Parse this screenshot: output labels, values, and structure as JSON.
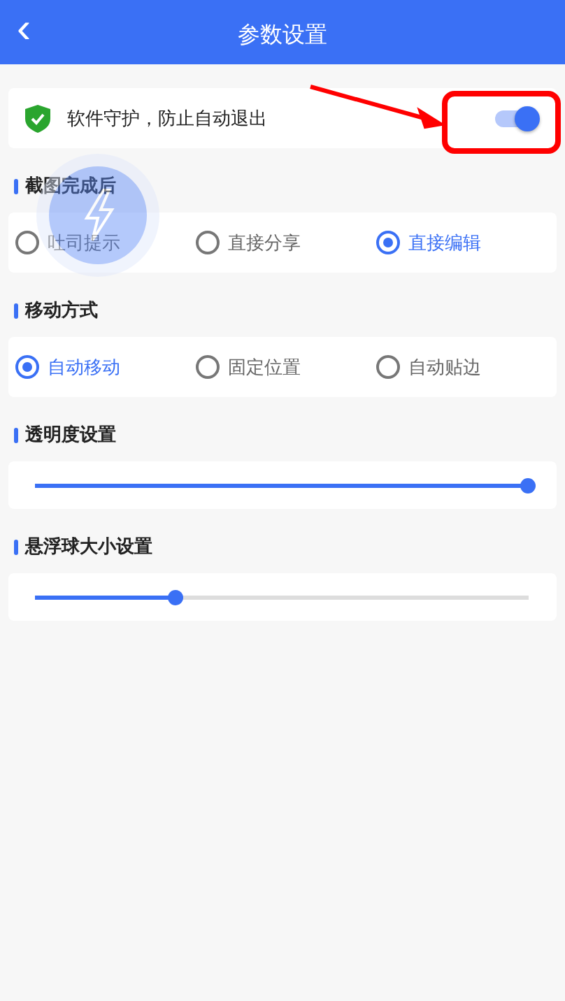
{
  "header": {
    "back": "‹",
    "title": "参数设置"
  },
  "protection": {
    "label": "软件守护，防止自动退出",
    "on": true
  },
  "sections": [
    {
      "kind": "radio",
      "title": "截图完成后",
      "options": [
        {
          "label": "吐司提示",
          "selected": false
        },
        {
          "label": "直接分享",
          "selected": false
        },
        {
          "label": "直接编辑",
          "selected": true
        }
      ]
    },
    {
      "kind": "radio",
      "title": "移动方式",
      "options": [
        {
          "label": "自动移动",
          "selected": true
        },
        {
          "label": "固定位置",
          "selected": false
        },
        {
          "label": "自动贴边",
          "selected": false
        }
      ]
    },
    {
      "kind": "slider",
      "title": "透明度设置",
      "level": 1
    },
    {
      "kind": "slider",
      "title": "悬浮球大小设置",
      "level": 0.286
    }
  ]
}
